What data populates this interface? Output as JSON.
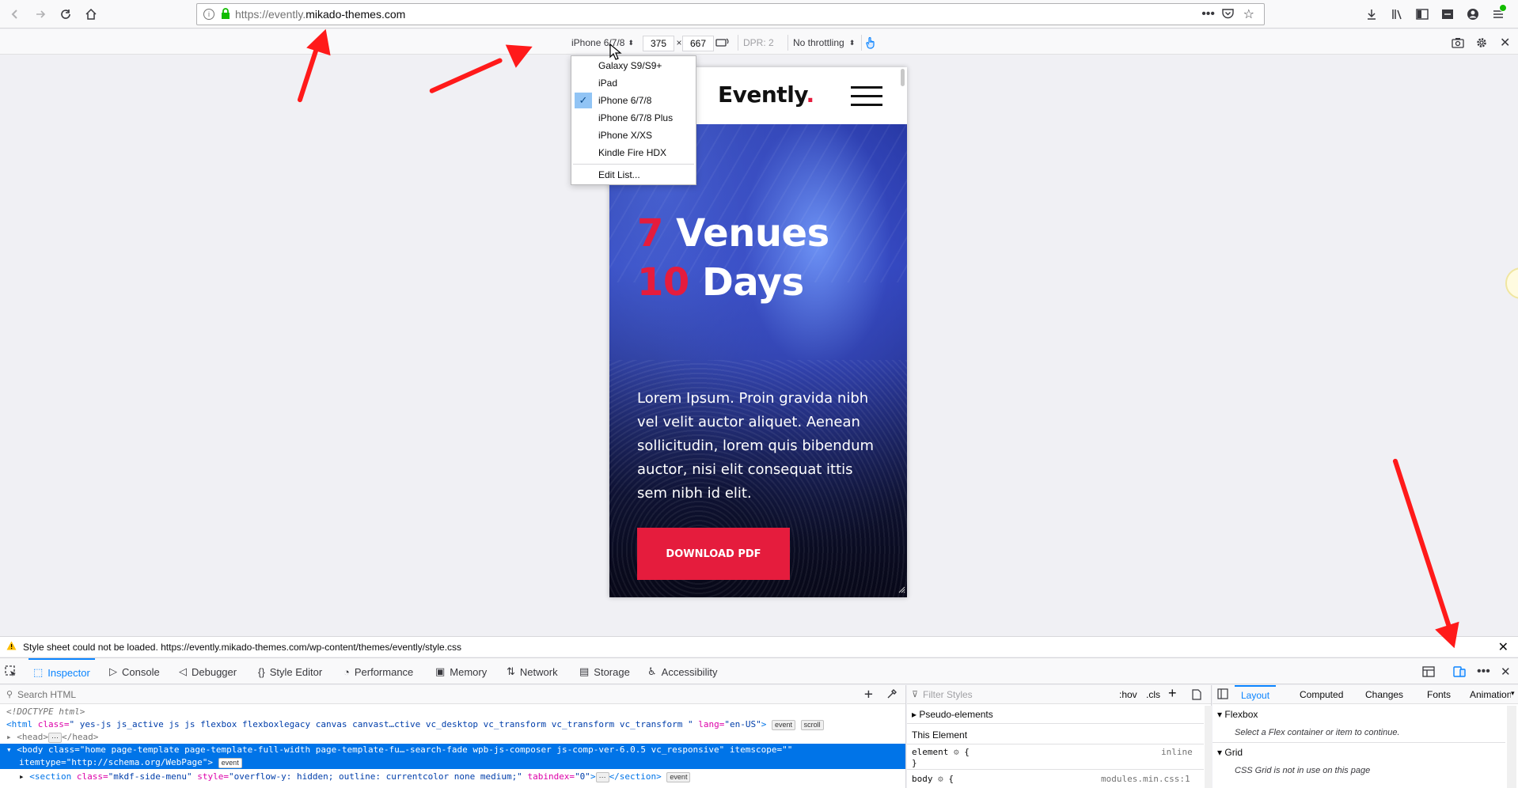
{
  "browser": {
    "url_prefix": "https://evently.",
    "url_domain": "mikado-themes.com",
    "icons": [
      "back-icon",
      "forward-icon",
      "reload-icon",
      "home-icon",
      "info-icon",
      "lock-icon",
      "page-actions-icon",
      "pocket-icon",
      "bookmark-star-icon",
      "library-icon",
      "sidebar-icon",
      "reader-icon",
      "account-icon"
    ]
  },
  "rdm": {
    "device": "iPhone 6/7/8",
    "width": "375",
    "times": "×",
    "height": "667",
    "dpr": "DPR: 2",
    "throttling": "No throttling"
  },
  "device_menu": {
    "items": [
      "Galaxy S9/S9+",
      "iPad",
      "iPhone 6/7/8",
      "iPhone 6/7/8 Plus",
      "iPhone X/XS",
      "Kindle Fire HDX"
    ],
    "selected": "iPhone 6/7/8",
    "edit": "Edit List..."
  },
  "site": {
    "logo": "Evently",
    "logo_dot": ".",
    "line1_num": "7",
    "line1_word": "Venues",
    "line2_num": "10",
    "line2_word": "Days",
    "body": "Lorem Ipsum. Proin gravida nibh vel velit auctor aliquet. Aenean sollicitudin, lorem quis bibendum auctor, nisi elit consequat ittis sem nibh id elit.",
    "cta": "DOWNLOAD PDF",
    "accent": "#e51c3d"
  },
  "notice": {
    "text": "Style sheet could not be loaded. https://evently.mikado-themes.com/wp-content/themes/evently/style.css"
  },
  "devtools": {
    "tabs": [
      "Inspector",
      "Console",
      "Debugger",
      "Style Editor",
      "Performance",
      "Memory",
      "Network",
      "Storage",
      "Accessibility"
    ],
    "active_tab": "Inspector",
    "search_placeholder": "Search HTML",
    "filter_placeholder": "Filter Styles",
    "hov": ":hov",
    "cls": ".cls",
    "layout_tabs": [
      "Layout",
      "Computed",
      "Changes",
      "Fonts",
      "Animations"
    ],
    "markup": {
      "doctype": "<!DOCTYPE html>",
      "html_open": "<html",
      "html_class_attr": "class=",
      "html_class_val": "\" yes-js js_active js js flexbox flexboxlegacy canvas canvast…ctive vc_desktop vc_transform vc_transform vc_transform \"",
      "html_lang_attr": "lang=",
      "html_lang_val": "\"en-US\"",
      "event": "event",
      "scroll": "scroll",
      "head": "<head>",
      "head_close": "</head>",
      "ellipsis": "⋯",
      "body_line": "<body class=\"home page-template page-template-full-width page-template-fu…-search-fade wpb-js-composer js-comp-ver-6.0.5 vc_responsive\" itemscope=\"\"",
      "body_line2": "itemtype=\"http://schema.org/WebPage\">",
      "section_open": "<section",
      "section_class_attr": "class=",
      "section_class_val": "\"mkdf-side-menu\"",
      "section_style_attr": "style=",
      "section_style_val": "\"overflow-y: hidden; outline: currentcolor none medium;\"",
      "section_tab_attr": "tabindex=",
      "section_tab_val": "\"0\"",
      "section_close": "</section>"
    },
    "rules": {
      "pseudo": "Pseudo-elements",
      "this_element": "This Element",
      "element_sel": "element",
      "brace_open": "{",
      "brace_close": "}",
      "inline": "inline",
      "body_sel": "body",
      "body_src": "modules.min.css:1"
    },
    "layout": {
      "flexbox": "Flexbox",
      "flexbox_hint": "Select a Flex container or item to continue.",
      "grid": "Grid",
      "grid_hint": "CSS Grid is not in use on this page"
    }
  }
}
